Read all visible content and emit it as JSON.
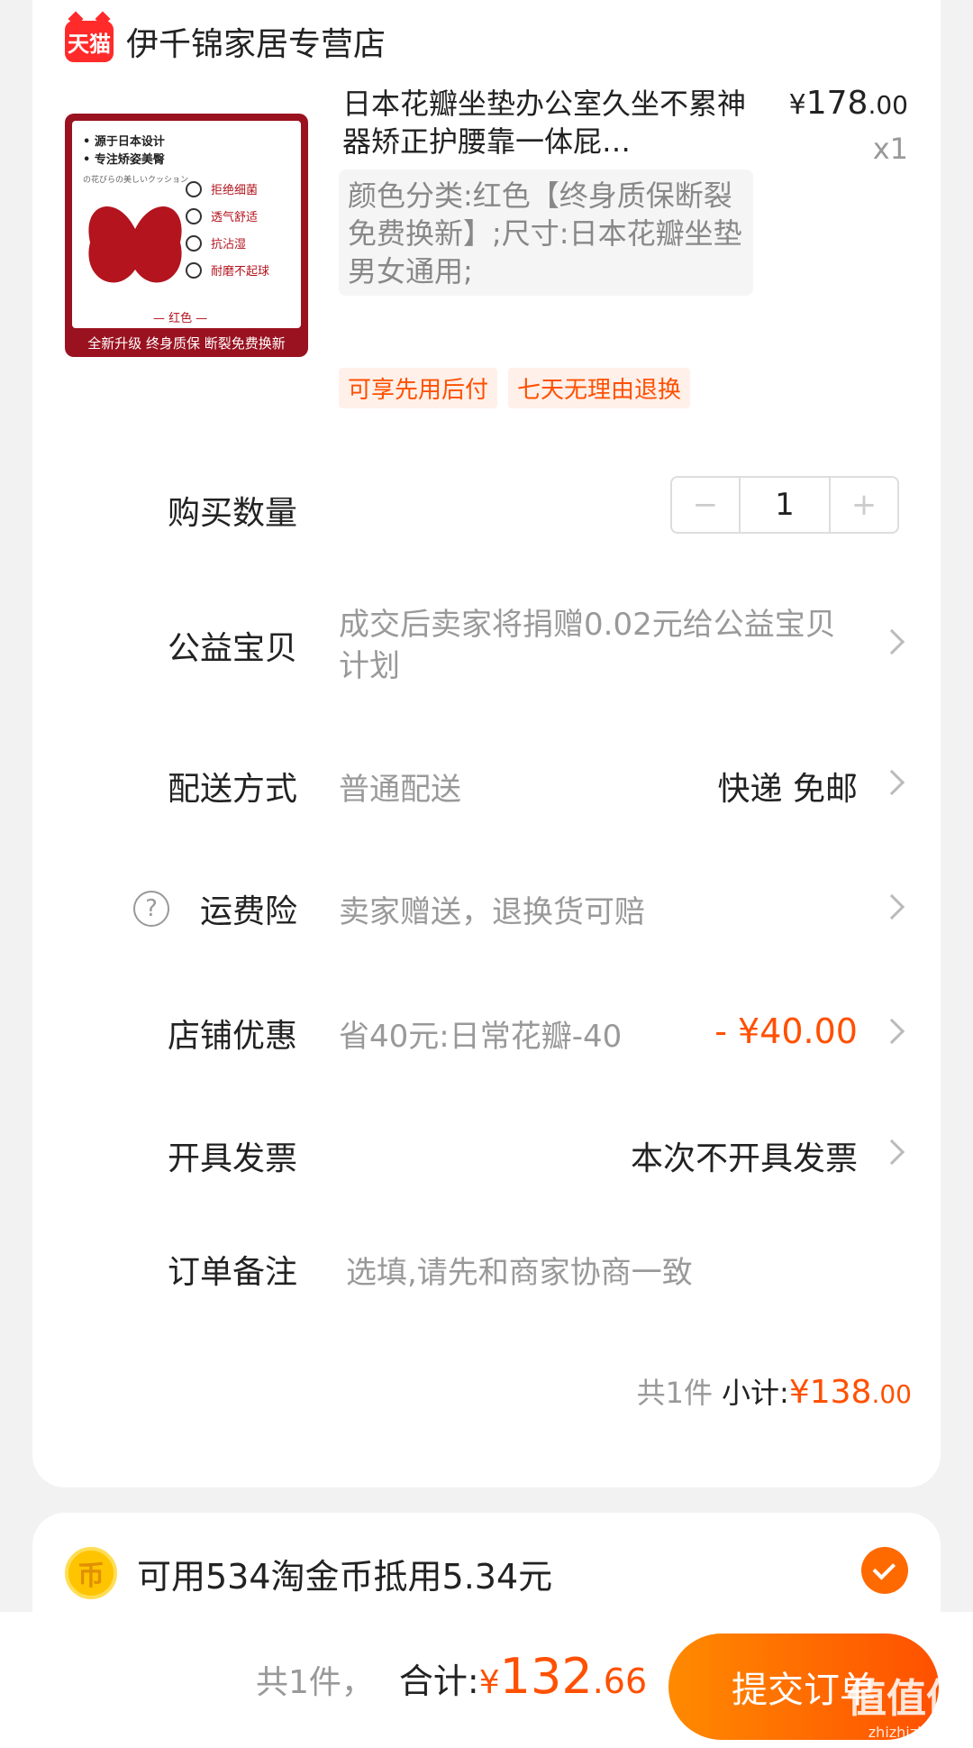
{
  "store": {
    "badge": "天猫",
    "name": "伊千锦家居专营店"
  },
  "product": {
    "title": "日本花瓣坐垫办公室久坐不累神器矫正护腰靠一体屁…",
    "price_yen": "¥",
    "price_int": "178",
    "price_dec": ".00",
    "quantity_mark": "x1",
    "sku": "颜色分类:红色【终身质保断裂免费换新】;尺寸:日本花瓣坐垫男女通用;",
    "image": {
      "line1": "• 源于日本设计",
      "line2": "• 专注矫姿美臀",
      "sub": "の花びらの美しいクッション",
      "features": [
        "拒绝细菌",
        "透气舒适",
        "抗沾湿",
        "耐磨不起球"
      ],
      "color_label": "— 红色 —",
      "footer": "全新升级  终身质保  断裂免费换新"
    },
    "tags": [
      "可享先用后付",
      "七天无理由退换"
    ]
  },
  "rows": {
    "quantity": {
      "label": "购买数量",
      "value": "1",
      "minus": "−",
      "plus": "+"
    },
    "charity": {
      "label": "公益宝贝",
      "value": "成交后卖家将捐赠0.02元给公益宝贝计划"
    },
    "delivery": {
      "label": "配送方式",
      "value": "普通配送",
      "right": "快递 免邮"
    },
    "insurance": {
      "label": "运费险",
      "help": "?",
      "value": "卖家赠送，退换货可赔"
    },
    "store_discount": {
      "label": "店铺优惠",
      "value": "省40元:日常花瓣-40",
      "amount": "- ¥40.00"
    },
    "invoice": {
      "label": "开具发票",
      "right": "本次不开具发票"
    },
    "note": {
      "label": "订单备注",
      "placeholder": "选填,请先和商家协商一致"
    }
  },
  "subtotal": {
    "count": "共1件",
    "label": "小计:",
    "yen": "¥",
    "int": "138",
    "dec": ".00"
  },
  "coins": {
    "icon": "币",
    "text": "可用534淘金币抵用5.34元"
  },
  "bottom": {
    "count": "共1件，",
    "label": "合计:",
    "yen": "¥",
    "int": "132",
    "dec": ".66",
    "submit": "提交订单"
  },
  "watermark": {
    "logo": "值值值",
    "url": "zhizhizhi.com"
  },
  "colors": {
    "accent": "#ff5000",
    "tmall_red": "#ff2a2a",
    "product_red": "#b3141e"
  }
}
